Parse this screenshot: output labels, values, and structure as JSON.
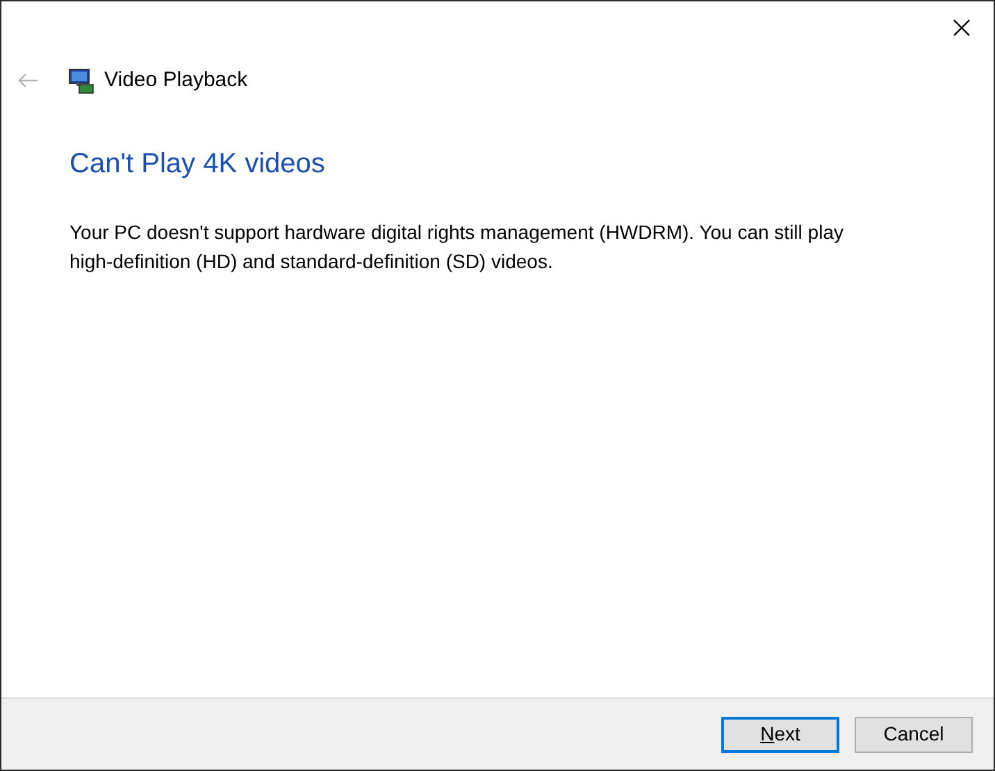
{
  "window": {
    "title": "Video Playback",
    "back_disabled": true
  },
  "heading": "Can't Play 4K videos",
  "message": "Your PC doesn't support hardware digital rights management (HWDRM). You can still play high-definition (HD) and standard-definition (SD) videos.",
  "buttons": [
    {
      "label_parts": [
        {
          "text": "N",
          "underlined": true
        },
        {
          "text": "ext",
          "underlined": false
        }
      ],
      "default": true
    },
    {
      "label_parts": [
        {
          "text": "Cancel",
          "underlined": false
        }
      ],
      "default": false
    }
  ]
}
